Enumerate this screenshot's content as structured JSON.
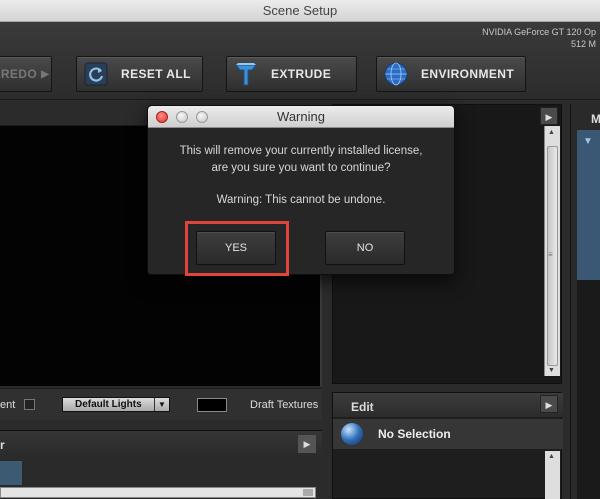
{
  "window": {
    "title": "Scene Setup"
  },
  "gpu": {
    "line1": "NVIDIA GeForce GT 120 Op",
    "line2": "512 M"
  },
  "toolbar": {
    "redo_label": "REDO",
    "reset_label": "RESET ALL",
    "extrude_label": "EXTRUDE",
    "environment_label": "ENVIRONMENT"
  },
  "options": {
    "left_label": "ent",
    "lights_value": "Default Lights",
    "draft_label": "Draft Textures"
  },
  "bottom_left": {
    "letter": "r"
  },
  "edit": {
    "title": "Edit",
    "selection": "No Selection"
  },
  "right_panel": {
    "letter": "M"
  },
  "dialog": {
    "title": "Warning",
    "message_line1": "This will remove your currently installed license,",
    "message_line2": "are you sure you want to continue?",
    "warning": "Warning: This cannot be undone.",
    "yes_label": "YES",
    "no_label": "NO"
  },
  "colors": {
    "highlight": "#e0453c",
    "accent_blue": "#3a5874"
  }
}
